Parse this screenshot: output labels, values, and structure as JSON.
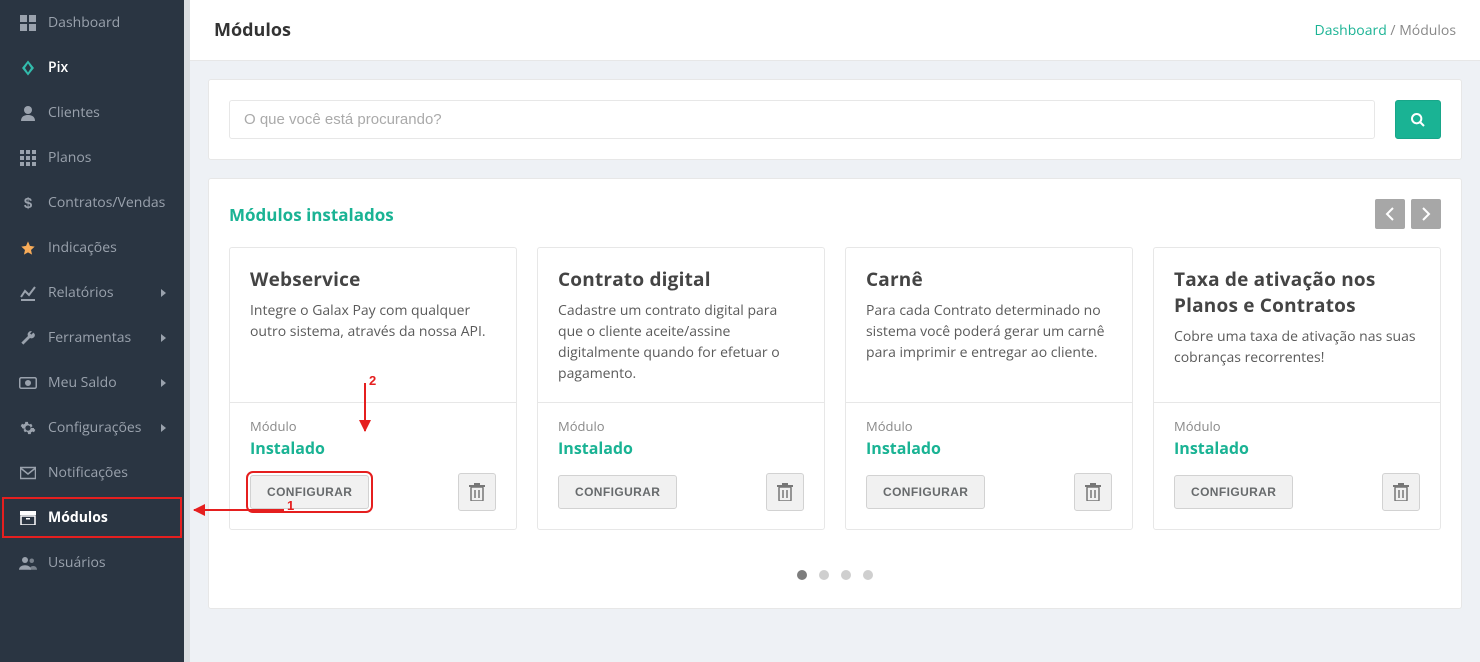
{
  "sidebar": {
    "items": [
      {
        "label": "Dashboard",
        "icon": "dashboard"
      },
      {
        "label": "Pix",
        "icon": "pix",
        "active_white": true
      },
      {
        "label": "Clientes",
        "icon": "person"
      },
      {
        "label": "Planos",
        "icon": "grid"
      },
      {
        "label": "Contratos/Vendas",
        "icon": "dollar"
      },
      {
        "label": "Indicações",
        "icon": "star"
      },
      {
        "label": "Relatórios",
        "icon": "chart",
        "chevron": true
      },
      {
        "label": "Ferramentas",
        "icon": "wrench",
        "chevron": true
      },
      {
        "label": "Meu Saldo",
        "icon": "money",
        "chevron": true
      },
      {
        "label": "Configurações",
        "icon": "gear",
        "chevron": true
      },
      {
        "label": "Notificações",
        "icon": "mail"
      },
      {
        "label": "Módulos",
        "icon": "archive",
        "active": true,
        "highlight": true
      },
      {
        "label": "Usuários",
        "icon": "users"
      }
    ]
  },
  "header": {
    "title": "Módulos",
    "breadcrumb_link": "Dashboard",
    "breadcrumb_sep": " / ",
    "breadcrumb_current": "Módulos"
  },
  "search": {
    "placeholder": "O que você está procurando?"
  },
  "installed": {
    "title": "Módulos instalados",
    "status_label": "Módulo",
    "status_value": "Instalado",
    "configure_label": "CONFIGURAR",
    "cards": [
      {
        "title": "Webservice",
        "desc": "Integre o Galax Pay com qualquer outro sistema, através da nossa API.",
        "highlight_configure": true
      },
      {
        "title": "Contrato digital",
        "desc": "Cadastre um contrato digital para que o cliente aceite/assine digitalmente quando for efetuar o pagamento."
      },
      {
        "title": "Carnê",
        "desc": "Para cada Contrato determinado no sistema você poderá gerar um carnê para imprimir e entregar ao cliente."
      },
      {
        "title": "Taxa de ativação nos Planos e Contratos",
        "desc": "Cobre uma taxa de ativação nas suas cobranças recorrentes!"
      }
    ],
    "dots_count": 4,
    "dots_active": 0
  },
  "annotations": {
    "num1": "1",
    "num2": "2"
  }
}
